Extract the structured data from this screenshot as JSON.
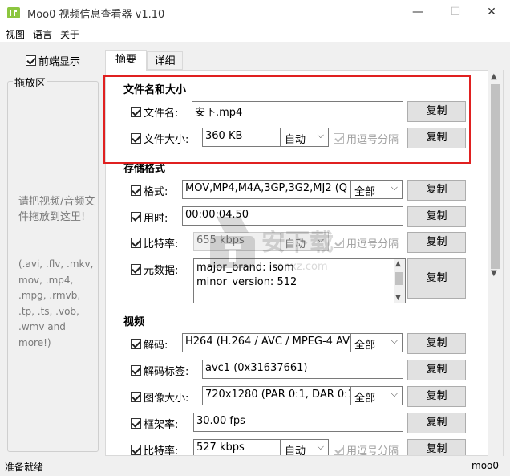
{
  "window": {
    "title": "Moo0 视频信息查看器 v1.10",
    "minimize_glyph": "—",
    "maximize_glyph": "☐",
    "close_glyph": "✕",
    "icon": "moo0-app-icon"
  },
  "menu": {
    "view": "视图",
    "language": "语言",
    "about": "关于"
  },
  "sidebar": {
    "topmost_label": "前端显示",
    "dropzone_title": "拖放区",
    "dropzone_hint": "请把视频/音频文件拖放到这里!",
    "dropzone_formats": "(.avi, .flv, .mkv, mov, .mp4, .mpg, .rmvb, .tp, .ts, .vob, .wmv and more!)"
  },
  "tabs": {
    "summary": "摘要",
    "detail": "详细"
  },
  "sections": {
    "file": "文件名和大小",
    "container": "存储格式",
    "video": "视频"
  },
  "file": {
    "name_label": "文件名:",
    "name_value": "安下.mp4",
    "size_label": "文件大小:",
    "size_value": "360 KB",
    "size_unit": "自动",
    "comma_label": "用逗号分隔"
  },
  "container": {
    "format_label": "格式:",
    "format_value": "MOV,MP4,M4A,3GP,3G2,MJ2  (Q",
    "format_scope": "全部",
    "duration_label": "用时:",
    "duration_value": "00:00:04.50",
    "bitrate_label": "比特率:",
    "bitrate_value": "655 kbps",
    "bitrate_unit": "自动",
    "comma_label": "用逗号分隔",
    "metadata_label": "元数据:",
    "metadata_lines": [
      "major_brand: isom",
      "minor_version: 512"
    ]
  },
  "video": {
    "codec_label": "解码:",
    "codec_value": "H264  (H.264 / AVC / MPEG-4 AV",
    "codec_scope": "全部",
    "codec_tag_label": "解码标签:",
    "codec_tag_value": "avc1 (0x31637661)",
    "image_size_label": "图像大小:",
    "image_size_value": "720x1280  (PAR 0:1, DAR 0:1",
    "image_size_scope": "全部",
    "framerate_label": "框架率:",
    "framerate_value": "30.00 fps",
    "bitrate_label": "比特率:",
    "bitrate_value": "527 kbps",
    "bitrate_unit": "自动",
    "comma_label": "用逗号分隔"
  },
  "buttons": {
    "copy": "复制"
  },
  "status": {
    "text": "准备就绪",
    "link": "moo0"
  },
  "watermark": {
    "text": "安下载",
    "subtext": "anxz.com"
  },
  "colors": {
    "highlight": "#e02020"
  }
}
